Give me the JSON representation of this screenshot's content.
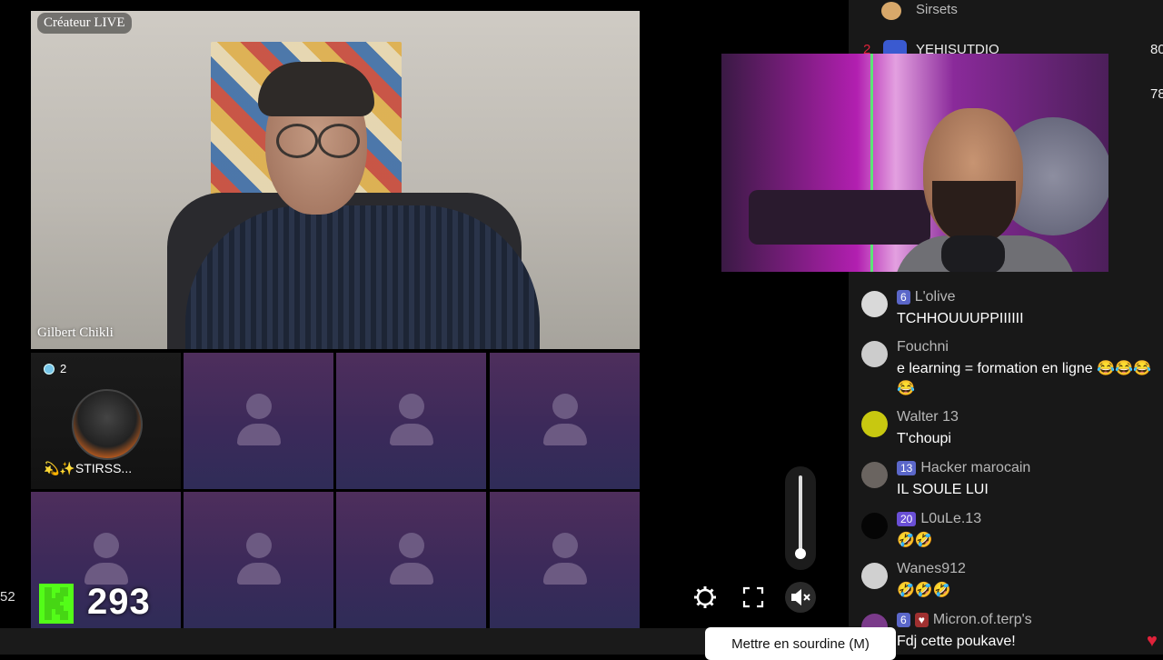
{
  "host": {
    "live_label": "Créateur LIVE",
    "name": "Gilbert Chikli"
  },
  "guest": {
    "badge_count": "2",
    "name": "💫✨STIRSS..."
  },
  "leaderboard": {
    "items": [
      {
        "rank": "",
        "name": "Sirsets",
        "score": ""
      },
      {
        "rank": "2",
        "name": "YEHISUTDIO",
        "score": "80"
      },
      {
        "rank": "",
        "name": "",
        "score": "78"
      }
    ]
  },
  "chat": {
    "messages": [
      {
        "level": "6",
        "user": "L'olive",
        "text": "TCHHOUUUPPIIIIII"
      },
      {
        "level": "",
        "user": "Fouchni",
        "text": "e learning = formation en ligne 😂😂😂😂"
      },
      {
        "level": "",
        "user": "Walter 13",
        "text": "T'choupi"
      },
      {
        "level": "13",
        "user": "Hacker marocain",
        "text": "IL SOULE LUI"
      },
      {
        "level": "20",
        "user": "L0uLe.13",
        "text": "🤣🤣"
      },
      {
        "level": "",
        "user": "Wanes912",
        "text": "🤣🤣🤣"
      },
      {
        "level": "6",
        "user": "Micron.of.terp's",
        "text": "Fdj cette poukave!"
      }
    ]
  },
  "controls": {
    "settings_icon": "gear-icon",
    "fullscreen_icon": "fullscreen-icon",
    "mute_icon": "speaker-muted-icon",
    "mute_tooltip": "Mettre en sourdine (M)",
    "volume_level": 0.05
  },
  "stats": {
    "viewer_count": "293",
    "left_edge_number": "52"
  },
  "colors": {
    "kick_green": "#53fc18",
    "grid_cell": "#3c2a5a",
    "chat_bg": "#181818"
  }
}
